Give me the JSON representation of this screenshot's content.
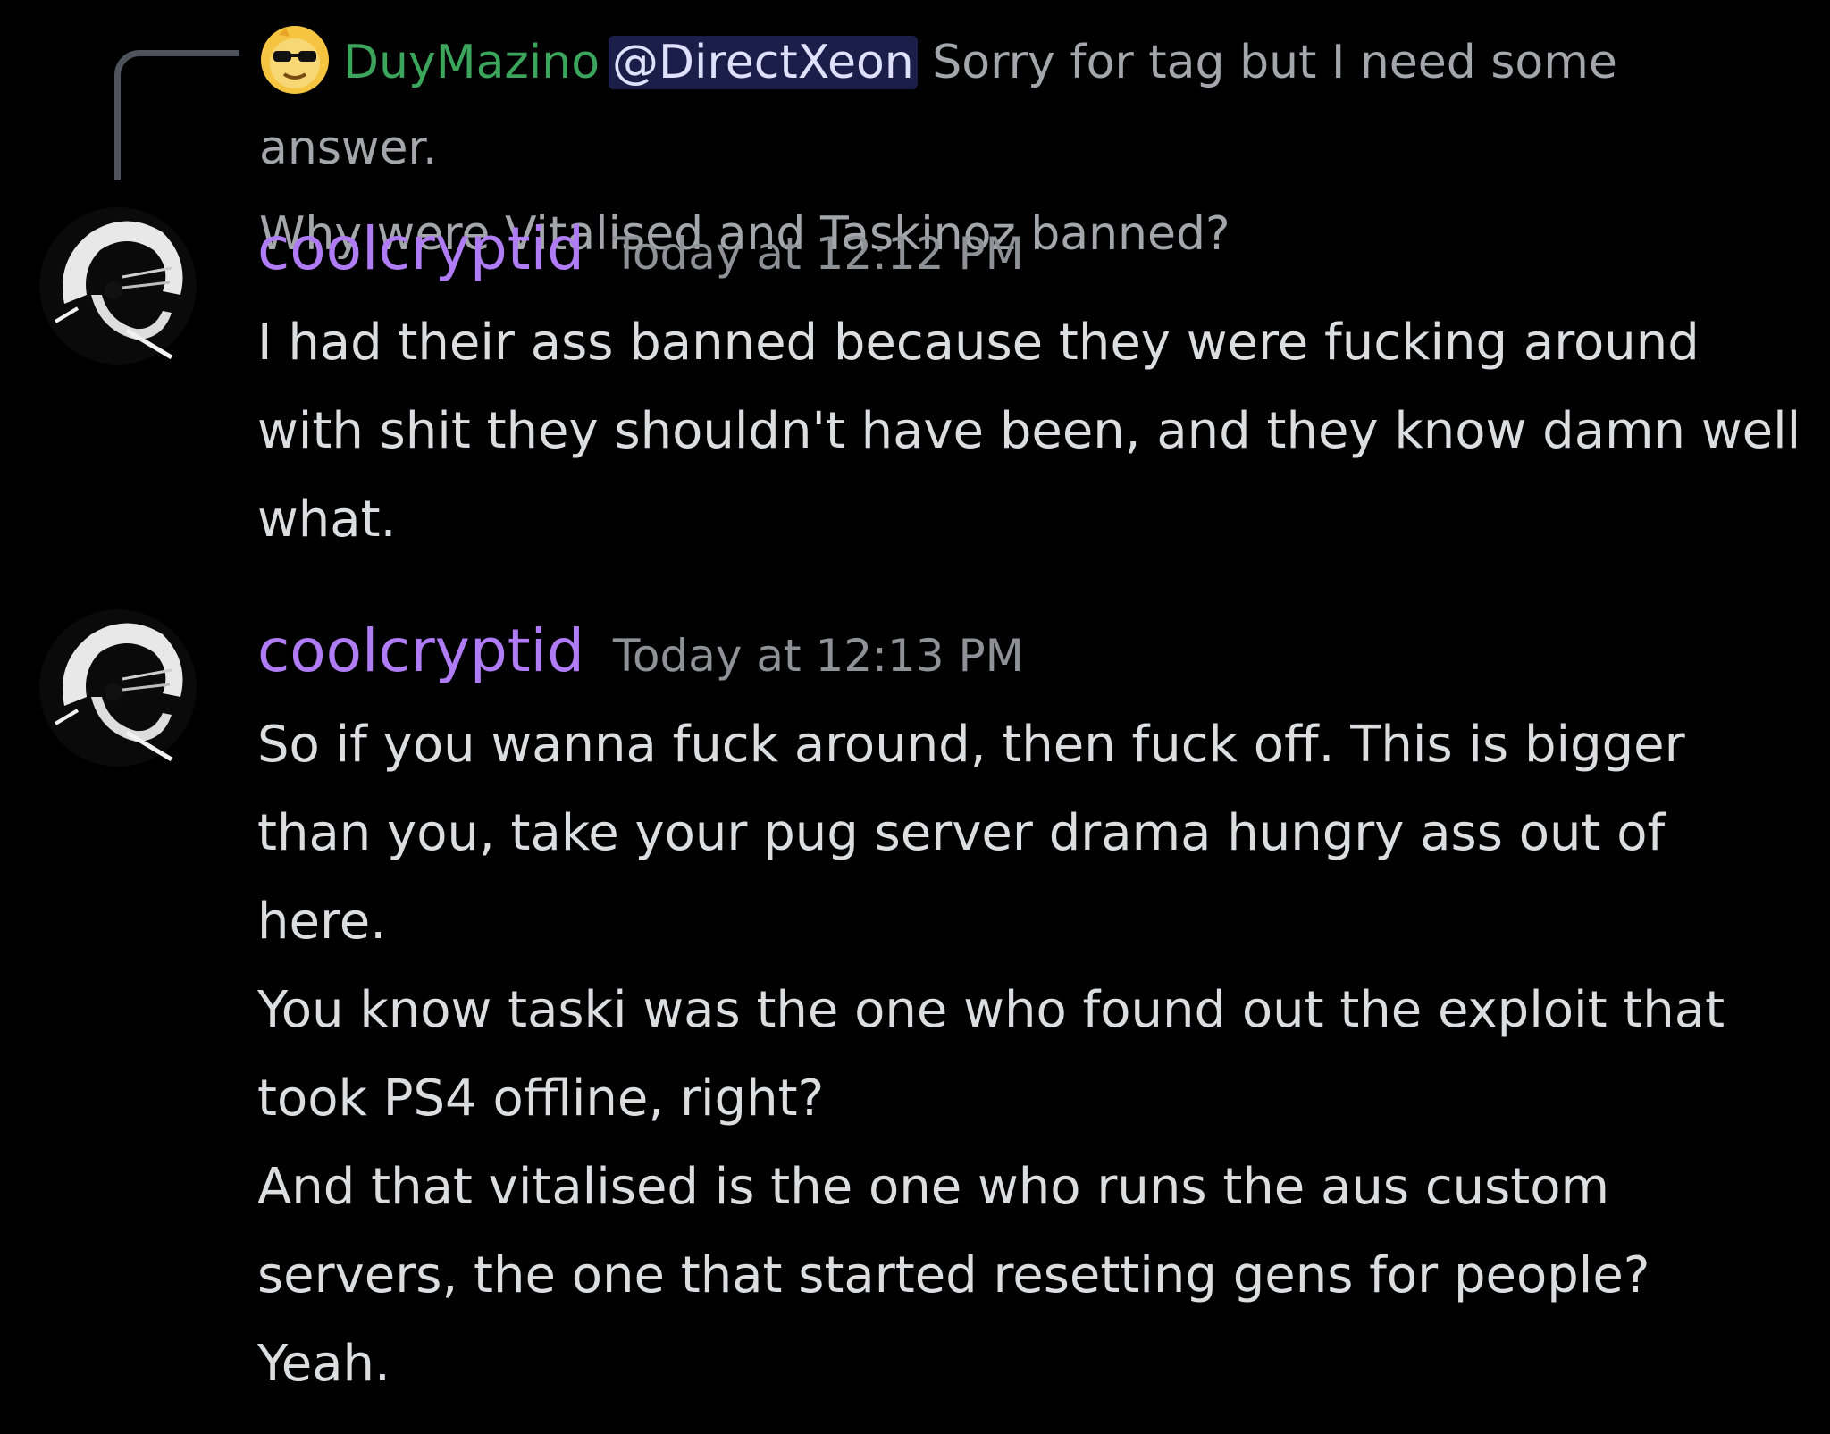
{
  "reply": {
    "author": "DuyMazino",
    "mention": "@DirectXeon",
    "text_after_mention": "Sorry for tag but I need some answer.",
    "text_line2": "Why were Vitalised and Taskinoz banned?"
  },
  "messages": [
    {
      "author": "coolcryptid",
      "timestamp": "Today at 12:12 PM",
      "lines": [
        "I had their ass banned because they were fucking around with shit they shouldn't have been, and they know damn well what."
      ]
    },
    {
      "author": "coolcryptid",
      "timestamp": "Today at 12:13 PM",
      "lines": [
        "So if you wanna fuck around, then fuck off. This is bigger than you, take your pug server drama hungry ass out of here.",
        "You know taski was the one who found out the exploit that took PS4 offline, right?",
        "And that vitalised is the one who runs the aus custom servers, the one that started resetting gens for people?",
        "Yeah."
      ]
    }
  ],
  "colors": {
    "background": "#000000",
    "reply_author": "#3ba55c",
    "username": "#b07cf6",
    "timestamp": "#8e9297",
    "text": "#dcddde",
    "mention_bg": "#2b2f5e"
  },
  "icons": {
    "reply_avatar": "sunglasses-face-icon",
    "message_avatar": "sketch-portrait-avatar"
  }
}
